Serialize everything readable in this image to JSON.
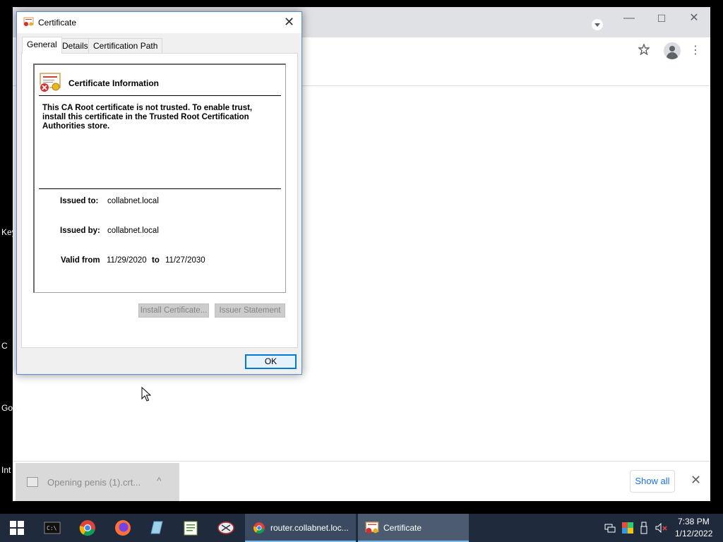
{
  "desktop": {
    "labels": [
      "Key",
      "C",
      "Go",
      "Int"
    ]
  },
  "chrome": {
    "minimize": "—",
    "maximize": "☐",
    "close": "✕",
    "star_icon": "star-icon",
    "profile_icon": "profile-icon",
    "menu_icon": "⋮"
  },
  "shelf": {
    "download_label": "Opening penis (1).crt...",
    "chevron": "^",
    "show_all": "Show all",
    "close": "✕"
  },
  "dialog": {
    "title": "Certificate",
    "close": "✕",
    "tabs": [
      "General",
      "Details",
      "Certification Path"
    ],
    "heading": "Certificate Information",
    "message": "This CA Root certificate is not trusted. To enable trust, install this certificate in the Trusted Root Certification Authorities store.",
    "issued_to_label": "Issued to:",
    "issued_to_value": "collabnet.local",
    "issued_by_label": "Issued by:",
    "issued_by_value": "collabnet.local",
    "valid_from_label": "Valid from",
    "valid_from_value": "11/29/2020",
    "valid_to_label": "to",
    "valid_to_value": "11/27/2030",
    "install_button": "Install Certificate...",
    "issuer_statement_button": "Issuer Statement",
    "ok_button": "OK"
  },
  "taskbar": {
    "tasks": [
      {
        "label": "router.collabnet.loc...",
        "icon": "chrome-icon"
      },
      {
        "label": "Certificate",
        "icon": "certificate-icon"
      }
    ],
    "clock_time": "7:38 PM",
    "clock_date": "1/12/2022"
  },
  "colors": {
    "accent": "#0078d7",
    "taskbar": "#1f2a3c",
    "link_blue": "#1a73e8"
  }
}
